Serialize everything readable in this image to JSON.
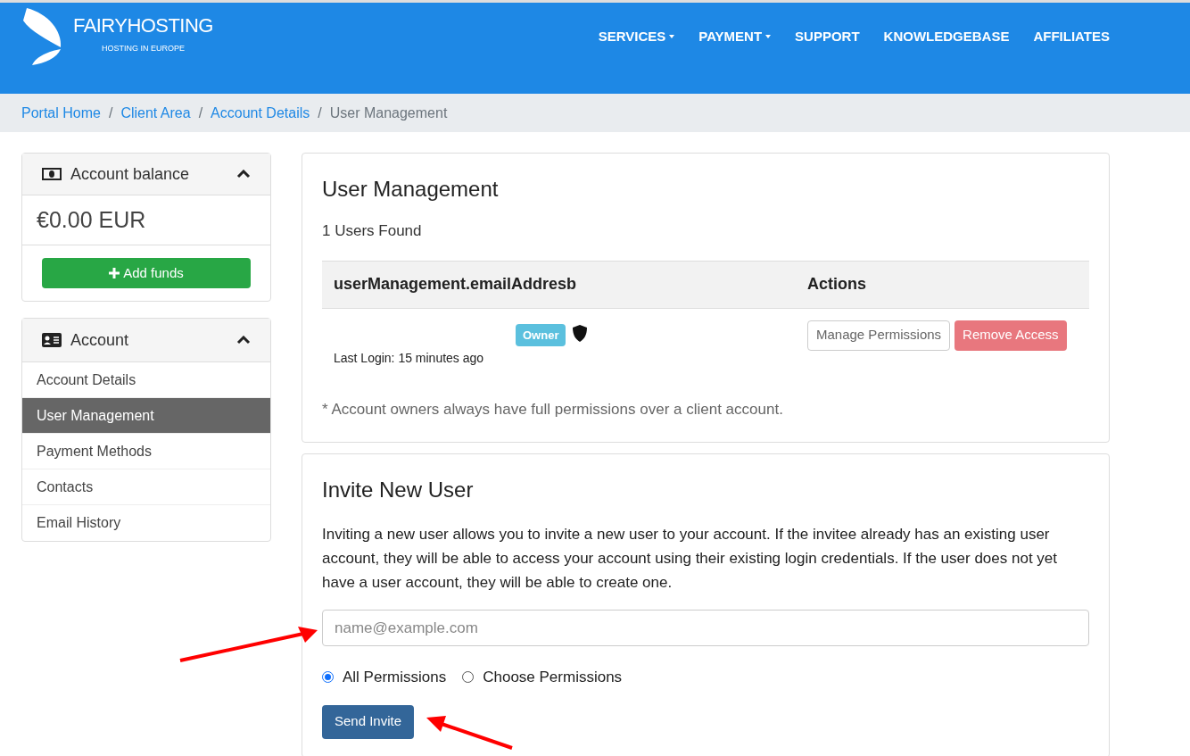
{
  "header": {
    "logo_title": "FAIRYHOSTING",
    "logo_subtitle": "HOSTING IN EUROPE",
    "nav": [
      {
        "label": "SERVICES",
        "dropdown": true
      },
      {
        "label": "PAYMENT",
        "dropdown": true
      },
      {
        "label": "SUPPORT",
        "dropdown": false
      },
      {
        "label": "KNOWLEDGEBASE",
        "dropdown": false
      },
      {
        "label": "AFFILIATES",
        "dropdown": false
      }
    ]
  },
  "breadcrumb": [
    {
      "label": "Portal Home",
      "link": true
    },
    {
      "label": "Client Area",
      "link": true
    },
    {
      "label": "Account Details",
      "link": true
    },
    {
      "label": "User Management",
      "link": false
    }
  ],
  "breadcrumb_separator": "/",
  "balance_panel": {
    "title": "Account balance",
    "amount": "€0.00 EUR",
    "button": "Add funds",
    "expanded": true
  },
  "account_panel": {
    "title": "Account",
    "expanded": true,
    "items": [
      {
        "label": "Account Details",
        "selected": false
      },
      {
        "label": "User Management",
        "selected": true
      },
      {
        "label": "Payment Methods",
        "selected": false
      },
      {
        "label": "Contacts",
        "selected": false
      },
      {
        "label": "Email History",
        "selected": false
      }
    ]
  },
  "user_management": {
    "title": "User Management",
    "count": "1 Users Found",
    "columns": [
      "userManagement.emailAddresb",
      "Actions"
    ],
    "rows": [
      {
        "badge": "Owner",
        "last_login": "Last Login: 15 minutes ago",
        "actions": [
          "Manage Permissions",
          "Remove Access"
        ]
      }
    ],
    "note": "* Account owners always have full permissions over a client account."
  },
  "invite": {
    "title": "Invite New User",
    "description": "Inviting a new user allows you to invite a new user to your account. If the invitee already has an existing user account, they will be able to access your account using their existing login credentials. If the user does not yet have a user account, they will be able to create one.",
    "email": {
      "placeholder": "name@example.com"
    },
    "permissions": [
      {
        "label": "All Permissions",
        "selected": true
      },
      {
        "label": "Choose Permissions",
        "selected": false
      }
    ],
    "button": "Send Invite"
  }
}
